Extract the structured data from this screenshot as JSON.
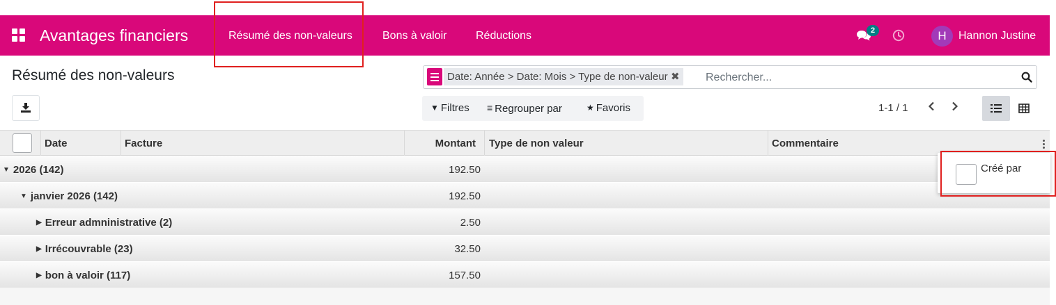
{
  "navbar": {
    "app_name": "Avantages financiers",
    "menu": [
      {
        "label": "Résumé des non-valeurs"
      },
      {
        "label": "Bons à valoir"
      },
      {
        "label": "Réductions"
      }
    ],
    "chat_badge": "2",
    "avatar_letter": "H",
    "user_name": "Hannon Justine",
    "brand_color": "#d9087a"
  },
  "control_panel": {
    "title": "Résumé des non-valeurs",
    "facet": "Date: Année > Date: Mois > Type de non-valeur",
    "search_placeholder": "Rechercher...",
    "filters_label": "Filtres",
    "group_by_label": "Regrouper par",
    "favorites_label": "Favoris",
    "pager": "1-1 / 1"
  },
  "table": {
    "columns": {
      "date": "Date",
      "facture": "Facture",
      "montant": "Montant",
      "type": "Type de non valeur",
      "commentaire": "Commentaire"
    },
    "groups": [
      {
        "label": "2026 (142)",
        "amount": "192.50",
        "level": 0,
        "expanded": true
      },
      {
        "label": "janvier 2026 (142)",
        "amount": "192.50",
        "level": 1,
        "expanded": true
      },
      {
        "label": "Erreur admninistrative (2)",
        "amount": "2.50",
        "level": 2,
        "expanded": false
      },
      {
        "label": "Irrécouvrable (23)",
        "amount": "32.50",
        "level": 2,
        "expanded": false
      },
      {
        "label": "bon à valoir (117)",
        "amount": "157.50",
        "level": 2,
        "expanded": false
      }
    ],
    "optional_columns": [
      {
        "label": "Créé par",
        "checked": false
      }
    ]
  }
}
